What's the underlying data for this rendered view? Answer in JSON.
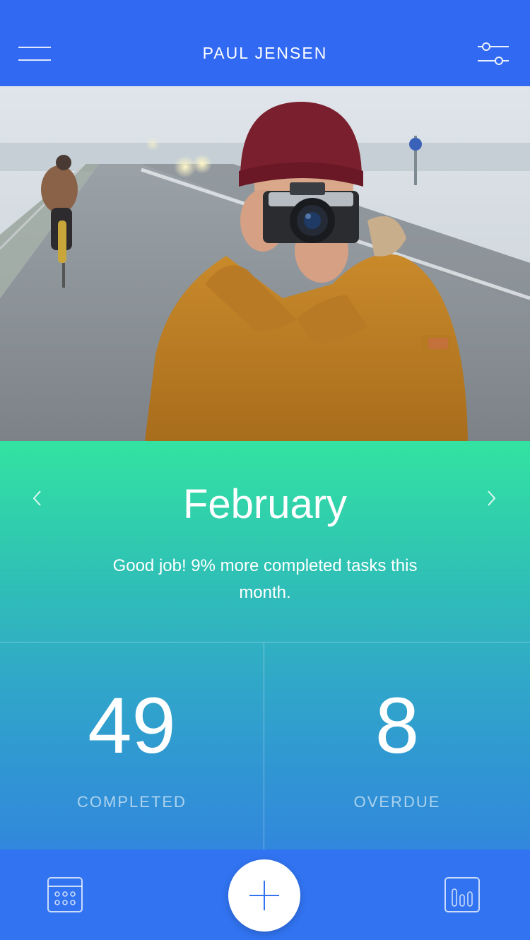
{
  "header": {
    "title": "PAUL JENSEN",
    "menu_icon": "hamburger-menu-icon",
    "filter_icon": "sliders-icon"
  },
  "photo": {
    "subject": "cover-photo"
  },
  "stats": {
    "month": "February",
    "message": "Good job! 9% more completed tasks this month.",
    "prev_icon": "chevron-left-icon",
    "next_icon": "chevron-right-icon",
    "completed": {
      "value": "49",
      "label": "COMPLETED"
    },
    "overdue": {
      "value": "8",
      "label": "OVERDUE"
    }
  },
  "bottom_nav": {
    "calendar_icon": "calendar-icon",
    "add_icon": "plus-icon",
    "stats_icon": "bar-chart-icon"
  },
  "colors": {
    "header": "#3169f2",
    "gradient_top": "#33e3a1",
    "gradient_bottom": "#3187dc",
    "bottom_bar": "#3173f0",
    "fab": "#ffffff"
  }
}
